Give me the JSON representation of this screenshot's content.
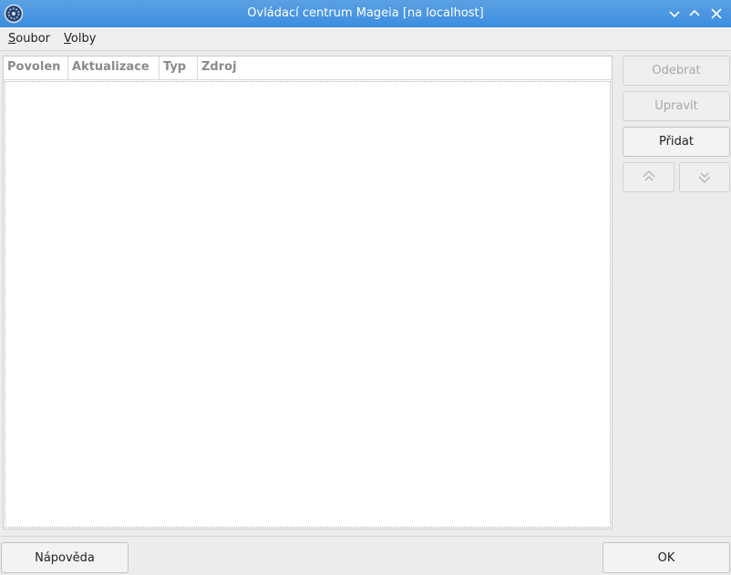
{
  "window": {
    "title": "Ovládací centrum Mageia [na localhost]"
  },
  "menu": [
    {
      "mnemonic": "S",
      "rest": "oubor"
    },
    {
      "mnemonic": "V",
      "rest": "olby"
    }
  ],
  "table": {
    "columns": [
      "Povolen",
      "Aktualizace",
      "Typ",
      "Zdroj"
    ],
    "rows": []
  },
  "side_buttons": {
    "remove": "Odebrat",
    "edit": "Upravit",
    "add": "Přidat"
  },
  "footer": {
    "help": "Nápověda",
    "ok": "OK"
  }
}
